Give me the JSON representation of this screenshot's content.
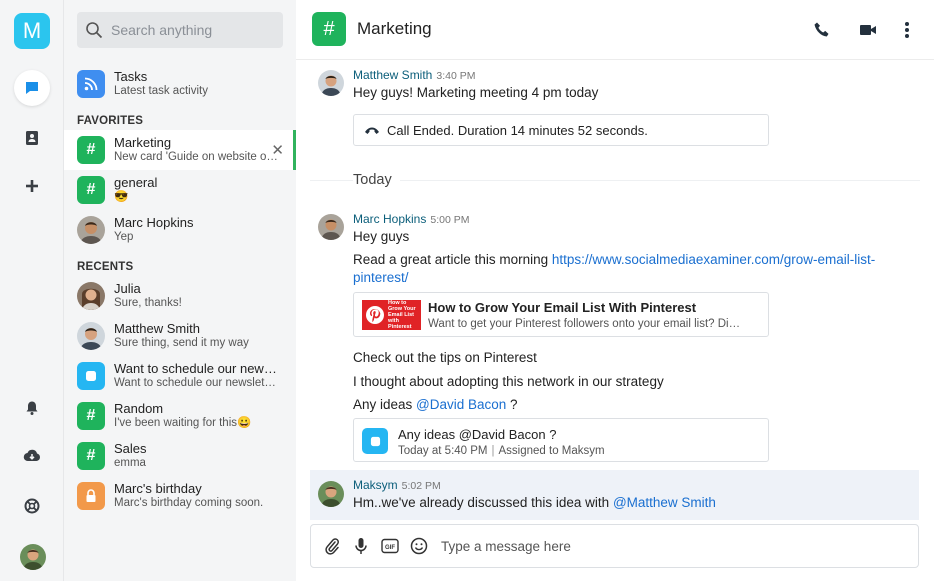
{
  "app": {
    "logo_letter": "M",
    "accent": "#2bc5ee",
    "channel_green": "#1fb35c"
  },
  "search": {
    "placeholder": "Search anything"
  },
  "sidebar": {
    "tasks": {
      "title": "Tasks",
      "subtitle": "Latest task activity"
    },
    "favorites_label": "FAVORITES",
    "favorites": [
      {
        "title": "Marketing",
        "subtitle": "New card 'Guide on website o…",
        "icon": "hash-icon"
      },
      {
        "title": "general",
        "subtitle": "😎",
        "icon": "hash-icon"
      },
      {
        "title": "Marc Hopkins",
        "subtitle": "Yep",
        "icon": "avatar"
      }
    ],
    "recents_label": "RECENTS",
    "recents": [
      {
        "title": "Julia",
        "subtitle": "Sure, thanks!",
        "icon": "avatar"
      },
      {
        "title": "Matthew Smith",
        "subtitle": "Sure thing, send it my way",
        "icon": "avatar"
      },
      {
        "title": "Want to schedule our newsl…",
        "subtitle": "Want to schedule our newslet…",
        "icon": "task-icon"
      },
      {
        "title": "Random",
        "subtitle": "I've been waiting for this😀",
        "icon": "hash-icon"
      },
      {
        "title": "Sales",
        "subtitle": "emma",
        "icon": "hash-icon"
      },
      {
        "title": "Marc's birthday",
        "subtitle": "Marc's birthday coming soon.",
        "icon": "lock-icon"
      }
    ]
  },
  "header": {
    "channel_name": "Marketing",
    "channel_symbol": "#"
  },
  "messages": {
    "m1": {
      "author": "Matthew Smith",
      "time": "3:40 PM",
      "text": "Hey guys! Marketing meeting 4 pm today"
    },
    "call": {
      "text": "Call Ended. Duration 14 minutes 52 seconds."
    },
    "day_separator": "Today",
    "m2": {
      "author": "Marc Hopkins",
      "time": "5:00 PM",
      "line1": "Hey guys",
      "line2_prefix": "Read a great article this morning ",
      "link_part1": "https://www.socialmediaexaminer.com/grow-email-list-",
      "link_part2": "pinterest/",
      "preview_title": "How to Grow Your Email List With Pinterest",
      "preview_desc": "Want to get your Pinterest followers onto your email list? Di…",
      "preview_thumb_text": "How to Grow Your Email List with Pinterest",
      "line3": "Check out the tips on Pinterest",
      "line4": "I thought about adopting this network in our strategy",
      "line5_prefix": "Any ideas ",
      "line5_mention": "@David Bacon",
      "line5_suffix": " ?",
      "task_title": "Any ideas @David Bacon ?",
      "task_meta_time": "Today at 5:40 PM",
      "task_meta_assigned": "Assigned to Maksym"
    },
    "m3": {
      "author": "Maksym",
      "time": "5:02 PM",
      "prefix": "Hm..we've already discussed this idea with ",
      "mention": "@Matthew Smith"
    }
  },
  "composer": {
    "placeholder": "Type a message here"
  }
}
